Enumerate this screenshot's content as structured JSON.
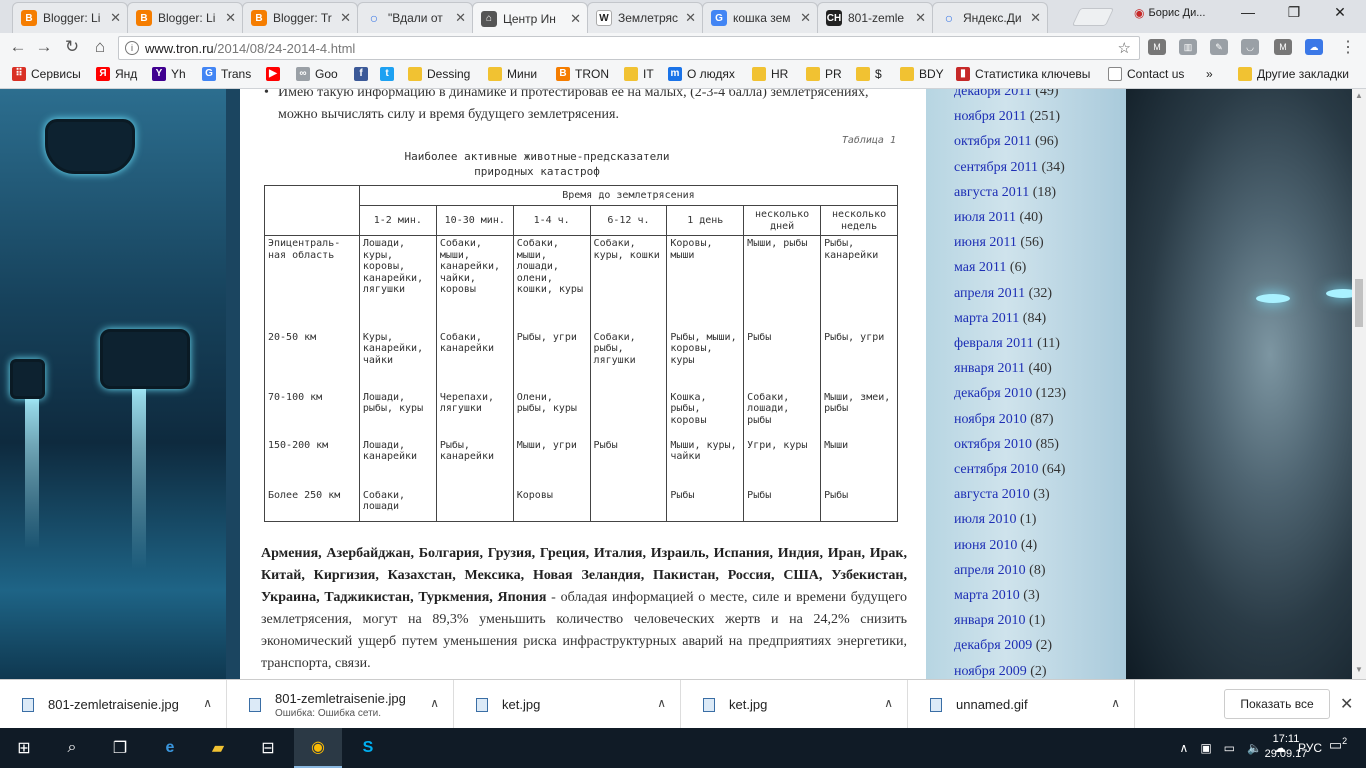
{
  "tabs": [
    {
      "title": "Blogger: Li",
      "icon": "blogger-icon",
      "color": "#f57d00",
      "glyph": "B"
    },
    {
      "title": "Blogger: Li",
      "icon": "blogger-icon",
      "color": "#f57d00",
      "glyph": "B"
    },
    {
      "title": "Blogger: Tr",
      "icon": "blogger-icon",
      "color": "#f57d00",
      "glyph": "B"
    },
    {
      "title": "\"Вдали от",
      "icon": "loading-icon",
      "color": "#3b78e7",
      "glyph": "○"
    },
    {
      "title": "Центр Ин",
      "icon": "tron-icon",
      "color": "#555555",
      "glyph": "⌂"
    },
    {
      "title": "Землетряс",
      "icon": "wikipedia-icon",
      "color": "#ffffff",
      "glyph": "W"
    },
    {
      "title": "кошка зем",
      "icon": "google-icon",
      "color": "#4285f4",
      "glyph": "G"
    },
    {
      "title": "801-zemle",
      "icon": "ch-icon",
      "color": "#222222",
      "glyph": "CH"
    },
    {
      "title": "Яндекс.Ди",
      "icon": "yandex-disk-icon",
      "color": "#3b78e7",
      "glyph": "○"
    }
  ],
  "profile_name": "Борис Ди...",
  "url": {
    "host": "www.tron.ru",
    "path": "/2014/08/24-2014-4.html"
  },
  "bookmarks": [
    {
      "label": "Сервисы",
      "icon": "apps-icon",
      "color": "#d93025",
      "glyph": "⠿"
    },
    {
      "label": "Янд",
      "icon": "yandex-icon",
      "color": "#ff0000",
      "glyph": "Я"
    },
    {
      "label": "Yh",
      "icon": "yahoo-icon",
      "color": "#400090",
      "glyph": "Y"
    },
    {
      "label": "Trans",
      "icon": "translate-icon",
      "color": "#4285f4",
      "glyph": "G"
    },
    {
      "label": "",
      "icon": "youtube-icon",
      "color": "#ff0000",
      "glyph": "▶"
    },
    {
      "label": "Goo",
      "icon": "google-photos-icon",
      "color": "#9aa0a6",
      "glyph": "∞"
    },
    {
      "label": "",
      "icon": "facebook-icon",
      "color": "#3b5998",
      "glyph": "f"
    },
    {
      "label": "",
      "icon": "twitter-icon",
      "color": "#1da1f2",
      "glyph": "t"
    },
    {
      "label": "Dessing",
      "icon": "folder-icon",
      "color": "#f1c232",
      "glyph": ""
    },
    {
      "label": "Мини",
      "icon": "folder-icon",
      "color": "#f1c232",
      "glyph": ""
    },
    {
      "label": "TRON",
      "icon": "blogger-icon",
      "color": "#f57d00",
      "glyph": "B"
    },
    {
      "label": "IT",
      "icon": "folder-icon",
      "color": "#f1c232",
      "glyph": ""
    },
    {
      "label": "О людях",
      "icon": "m-icon",
      "color": "#1a73e8",
      "glyph": "m"
    },
    {
      "label": "HR",
      "icon": "folder-icon",
      "color": "#f1c232",
      "glyph": ""
    },
    {
      "label": "PR",
      "icon": "folder-icon",
      "color": "#f1c232",
      "glyph": ""
    },
    {
      "label": "$",
      "icon": "folder-icon",
      "color": "#f1c232",
      "glyph": ""
    },
    {
      "label": "BDY",
      "icon": "folder-icon",
      "color": "#f1c232",
      "glyph": ""
    },
    {
      "label": "Статистика ключевы",
      "icon": "stats-icon",
      "color": "#c62828",
      "glyph": "▮"
    },
    {
      "label": "Contact us",
      "icon": "page-icon",
      "color": "#ffffff",
      "glyph": ""
    }
  ],
  "bookmarks_more": "»",
  "other_bookmarks": "Другие закладки",
  "article": {
    "bullet_text": "Имею такую информацию в динамике и протестировав ее на малых, (2-3-4 балла) землетрясениях, можно вычислять силу и время будущего землетрясения.",
    "table_num": "Таблица 1",
    "table_title_1": "Наиболее активные животные-предсказатели",
    "table_title_2": "природных катастроф",
    "time_header": "Время до землетрясения",
    "columns": [
      "1-2 мин.",
      "10-30 мин.",
      "1-4 ч.",
      "6-12 ч.",
      "1 день",
      "несколько дней",
      "несколько недель"
    ],
    "rows": [
      {
        "zone": "Эпицентраль-ная область",
        "cells": [
          "Лошади, куры, коровы, канарейки, лягушки",
          "Собаки, мыши, канарейки, чайки, коровы",
          "Собаки, мыши, лошади, олени, кошки, куры",
          "Собаки, куры, кошки",
          "Коровы, мыши",
          "Мыши, рыбы",
          "Рыбы, канарейки"
        ]
      },
      {
        "zone": "20-50 км",
        "cells": [
          "Куры, канарейки, чайки",
          "Собаки, канарейки",
          "Рыбы, угри",
          "Собаки, рыбы, лягушки",
          "Рыбы, мыши, коровы, куры",
          "Рыбы",
          "Рыбы, угри"
        ]
      },
      {
        "zone": "70-100 км",
        "cells": [
          "Лошади, рыбы, куры",
          "Черепахи, лягушки",
          "Олени, рыбы, куры",
          "",
          "Кошка, рыбы, коровы",
          "Собаки, лошади, рыбы",
          "Мыши, змеи, рыбы"
        ]
      },
      {
        "zone": "150-200 км",
        "cells": [
          "Лошади, канарейки",
          "Рыбы, канарейки",
          "Мыши, угри",
          "Рыбы",
          "Мыши, куры, чайки",
          "Угри, куры",
          "Мыши"
        ]
      },
      {
        "zone": "Более 250 км",
        "cells": [
          "Собаки, лошади",
          "",
          "Коровы",
          "",
          "Рыбы",
          "Рыбы",
          "Рыбы"
        ]
      }
    ],
    "para_bold": "Армения, Азербайджан, Болгария, Грузия, Греция, Италия, Израиль, Испания, Индия, Иран, Ирак, Китай, Киргизия, Казахстан, Мексика, Новая Зеландия, Пакистан, Россия, США, Узбекистан, Украина, Таджикистан, Туркмения, Япония",
    "para_rest": " - обладая информацией о месте, силе и времени будущего землетрясения, могут на 89,3% уменьшить количество человеческих жертв и на 24,2% снизить экономический ущерб путем уменьшения риска инфраструктурных аварий на предприятиях энергетики, транспорта, связи."
  },
  "archive": [
    {
      "month": "декабря 2011",
      "count": "(49)"
    },
    {
      "month": "ноября 2011",
      "count": "(251)"
    },
    {
      "month": "октября 2011",
      "count": "(96)"
    },
    {
      "month": "сентября 2011",
      "count": "(34)"
    },
    {
      "month": "августа 2011",
      "count": "(18)"
    },
    {
      "month": "июля 2011",
      "count": "(40)"
    },
    {
      "month": "июня 2011",
      "count": "(56)"
    },
    {
      "month": "мая 2011",
      "count": "(6)"
    },
    {
      "month": "апреля 2011",
      "count": "(32)"
    },
    {
      "month": "марта 2011",
      "count": "(84)"
    },
    {
      "month": "февраля 2011",
      "count": "(11)"
    },
    {
      "month": "января 2011",
      "count": "(40)"
    },
    {
      "month": "декабря 2010",
      "count": "(123)"
    },
    {
      "month": "ноября 2010",
      "count": "(87)"
    },
    {
      "month": "октября 2010",
      "count": "(85)"
    },
    {
      "month": "сентября 2010",
      "count": "(64)"
    },
    {
      "month": "августа 2010",
      "count": "(3)"
    },
    {
      "month": "июля 2010",
      "count": "(1)"
    },
    {
      "month": "июня 2010",
      "count": "(4)"
    },
    {
      "month": "апреля 2010",
      "count": "(8)"
    },
    {
      "month": "марта 2010",
      "count": "(3)"
    },
    {
      "month": "января 2010",
      "count": "(1)"
    },
    {
      "month": "декабря 2009",
      "count": "(2)"
    },
    {
      "month": "ноября 2009",
      "count": "(2)"
    }
  ],
  "downloads": [
    {
      "name": "801-zemletraisenie.jpg",
      "error": ""
    },
    {
      "name": "801-zemletraisenie.jpg",
      "error": "Ошибка: Ошибка сети."
    },
    {
      "name": "ket.jpg",
      "error": ""
    },
    {
      "name": "ket.jpg",
      "error": ""
    },
    {
      "name": "unnamed.gif",
      "error": ""
    }
  ],
  "show_all_label": "Показать все",
  "taskbar": {
    "lang": "РУС",
    "time": "17:11",
    "date": "29.09.17",
    "notif_count": "2"
  }
}
